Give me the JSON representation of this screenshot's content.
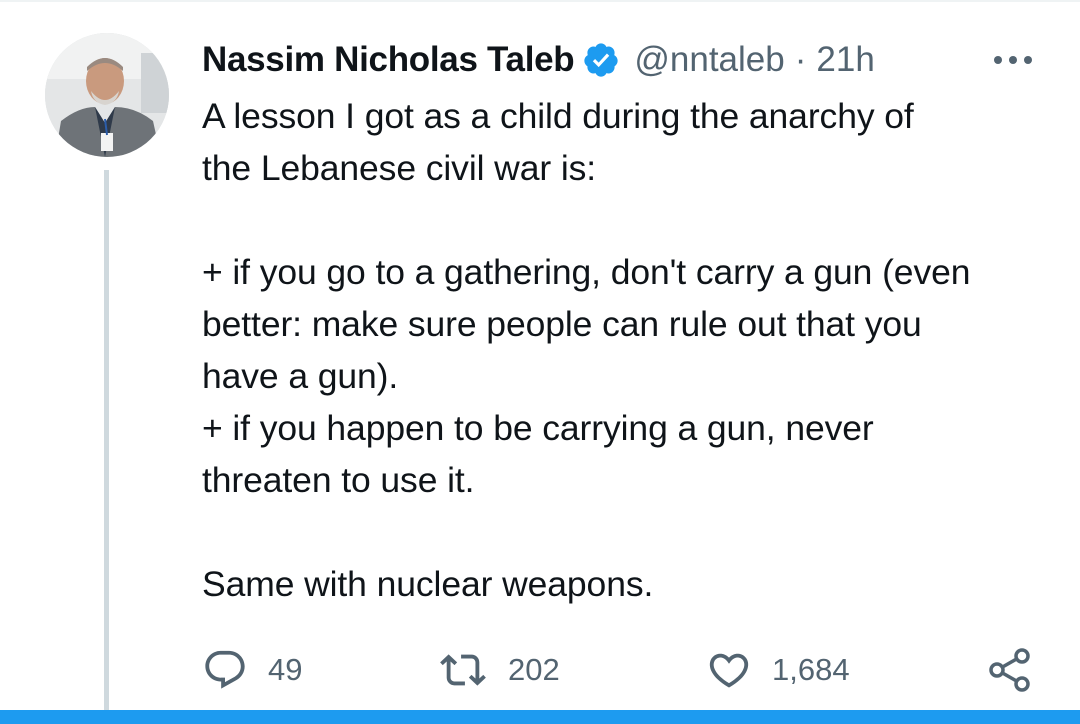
{
  "tweet": {
    "author_name": "Nassim Nicholas Taleb",
    "handle": "@nntaleb",
    "separator": "·",
    "timestamp": "21h",
    "verified": true,
    "text": "A lesson I got as a child during the anarchy of\nthe Lebanese civil war is:\n\n+ if you go to a gathering, don't carry a gun (even\nbetter: make sure people can rule out that you\nhave a gun).\n+ if you happen to be carrying a gun, never\nthreaten to use it.\n\nSame with nuclear weapons.",
    "replies": "49",
    "retweets": "202",
    "likes": "1,684"
  },
  "icons": {
    "verified": "verified-badge-icon",
    "more": "more-options-icon",
    "reply": "reply-icon",
    "retweet": "retweet-icon",
    "like": "heart-icon",
    "share": "share-icon"
  },
  "colors": {
    "accent": "#1d9bf0",
    "text_primary": "#0f1419",
    "text_secondary": "#536471",
    "thread_line": "#cfd9de"
  }
}
